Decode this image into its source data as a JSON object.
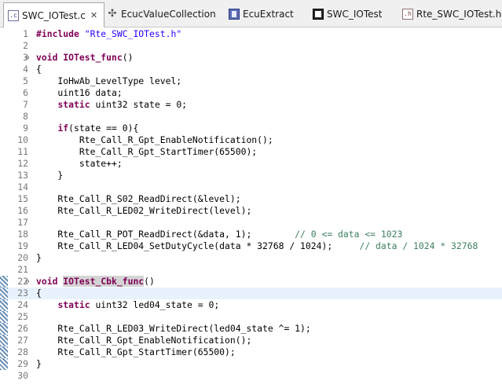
{
  "tabs": [
    {
      "label": "SWC_IOTest.c",
      "icon": "c-file-icon",
      "active": true
    },
    {
      "label": "EcucValueCollection",
      "icon": "cross-icon"
    },
    {
      "label": "EcuExtract",
      "icon": "book-icon"
    },
    {
      "label": "SWC_IOTest",
      "icon": "chip-icon"
    },
    {
      "label": "Rte_SWC_IOTest.h",
      "icon": "h-file-icon"
    }
  ],
  "close_glyph": "✕",
  "lines": [
    {
      "n": "1",
      "segments": [
        [
          "kw",
          "#include "
        ],
        [
          "str",
          "\"Rte_SWC_IOTest.h\""
        ]
      ]
    },
    {
      "n": "2",
      "segments": []
    },
    {
      "n": "3",
      "fold": "⊖",
      "segments": [
        [
          "kw",
          "void "
        ],
        [
          "kw",
          "IOTest_func"
        ],
        [
          "",
          "()"
        ]
      ]
    },
    {
      "n": "4",
      "segments": [
        [
          "",
          "{"
        ]
      ]
    },
    {
      "n": "5",
      "segments": [
        [
          "",
          "    IoHwAb_LevelType level;"
        ]
      ]
    },
    {
      "n": "6",
      "segments": [
        [
          "",
          "    uint16 data;"
        ]
      ]
    },
    {
      "n": "7",
      "segments": [
        [
          "",
          "    "
        ],
        [
          "kw",
          "static "
        ],
        [
          "",
          "uint32 state = 0;"
        ]
      ]
    },
    {
      "n": "8",
      "segments": []
    },
    {
      "n": "9",
      "segments": [
        [
          "",
          "    "
        ],
        [
          "kw",
          "if"
        ],
        [
          "",
          "(state == 0){"
        ]
      ]
    },
    {
      "n": "10",
      "segments": [
        [
          "",
          "        Rte_Call_R_Gpt_EnableNotification();"
        ]
      ]
    },
    {
      "n": "11",
      "segments": [
        [
          "",
          "        Rte_Call_R_Gpt_StartTimer(65500);"
        ]
      ]
    },
    {
      "n": "12",
      "segments": [
        [
          "",
          "        state++;"
        ]
      ]
    },
    {
      "n": "13",
      "segments": [
        [
          "",
          "    }"
        ]
      ]
    },
    {
      "n": "14",
      "segments": []
    },
    {
      "n": "15",
      "segments": [
        [
          "",
          "    Rte_Call_R_S02_ReadDirect(&level);"
        ]
      ]
    },
    {
      "n": "16",
      "segments": [
        [
          "",
          "    Rte_Call_R_LED02_WriteDirect(level);"
        ]
      ]
    },
    {
      "n": "17",
      "segments": []
    },
    {
      "n": "18",
      "segments": [
        [
          "",
          "    Rte_Call_R_POT_ReadDirect(&data, 1);        "
        ],
        [
          "com",
          "// 0 <= data <= 1023"
        ]
      ]
    },
    {
      "n": "19",
      "segments": [
        [
          "",
          "    Rte_Call_R_LED04_SetDutyCycle(data * 32768 / 1024);     "
        ],
        [
          "com",
          "// data / 1024 * 32768"
        ]
      ]
    },
    {
      "n": "20",
      "segments": [
        [
          "",
          "}"
        ]
      ]
    },
    {
      "n": "21",
      "segments": []
    },
    {
      "n": "22",
      "fold": "⊖",
      "marker": true,
      "segments": [
        [
          "kw",
          "void "
        ],
        [
          "hlfn",
          "IOTest_Cbk_func"
        ],
        [
          "",
          "()"
        ]
      ]
    },
    {
      "n": "23",
      "marker": true,
      "highlight": true,
      "segments": [
        [
          "",
          "{"
        ]
      ]
    },
    {
      "n": "24",
      "marker": true,
      "segments": [
        [
          "",
          "    "
        ],
        [
          "kw",
          "static "
        ],
        [
          "",
          "uint32 led04_state = 0;"
        ]
      ]
    },
    {
      "n": "25",
      "marker": true,
      "segments": []
    },
    {
      "n": "26",
      "marker": true,
      "segments": [
        [
          "",
          "    Rte_Call_R_LED03_WriteDirect(led04_state ^= 1);"
        ]
      ]
    },
    {
      "n": "27",
      "marker": true,
      "segments": [
        [
          "",
          "    Rte_Call_R_Gpt_EnableNotification();"
        ]
      ]
    },
    {
      "n": "28",
      "marker": true,
      "segments": [
        [
          "",
          "    Rte_Call_R_Gpt_StartTimer(65500);"
        ]
      ]
    },
    {
      "n": "29",
      "marker": true,
      "segments": [
        [
          "",
          "}"
        ]
      ]
    },
    {
      "n": "30",
      "segments": []
    }
  ]
}
